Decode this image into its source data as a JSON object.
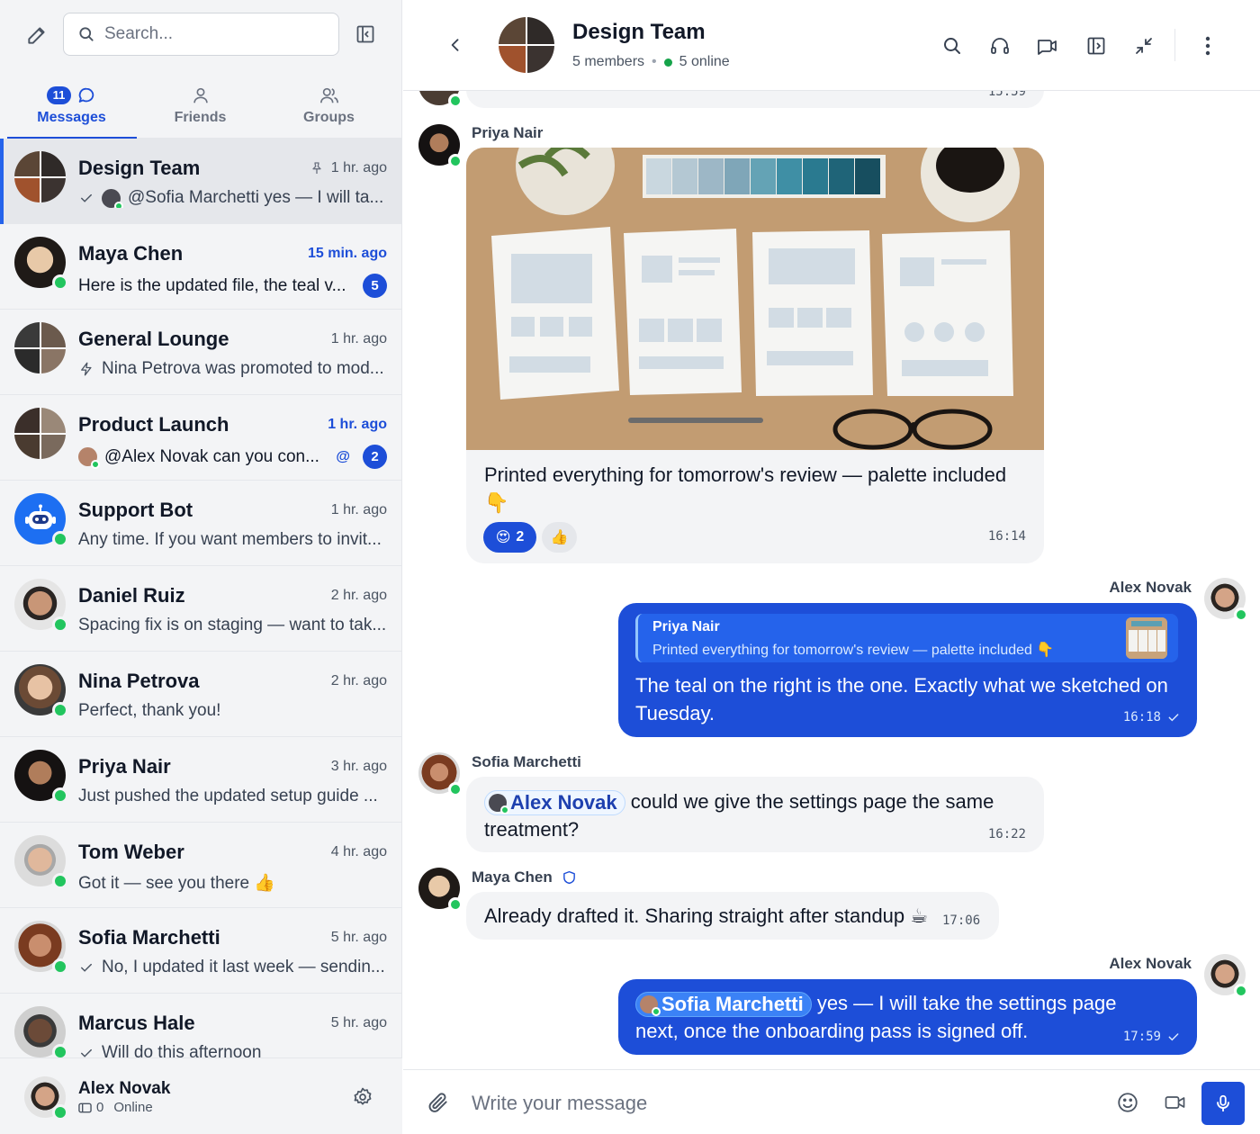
{
  "search": {
    "placeholder": "Search..."
  },
  "tabs": [
    {
      "label": "Messages",
      "badge": "11"
    },
    {
      "label": "Friends"
    },
    {
      "label": "Groups"
    }
  ],
  "conversations": [
    {
      "name": "Design Team",
      "time": "1 hr. ago",
      "preview": "@Sofia Marchetti yes — I will ta..."
    },
    {
      "name": "Maya Chen",
      "time": "15 min. ago",
      "preview": "Here is the updated file, the teal v...",
      "unread": "5"
    },
    {
      "name": "General Lounge",
      "time": "1 hr. ago",
      "preview": "Nina Petrova was promoted to mod..."
    },
    {
      "name": "Product Launch",
      "time": "1 hr. ago",
      "preview": "@Alex Novak can you con...",
      "mention": "@",
      "unread": "2"
    },
    {
      "name": "Support Bot",
      "time": "1 hr. ago",
      "preview": "Any time. If you want members to invit..."
    },
    {
      "name": "Daniel Ruiz",
      "time": "2 hr. ago",
      "preview": "Spacing fix is on staging — want to tak..."
    },
    {
      "name": "Nina Petrova",
      "time": "2 hr. ago",
      "preview": "Perfect, thank you!"
    },
    {
      "name": "Priya Nair",
      "time": "3 hr. ago",
      "preview": "Just pushed the updated setup guide ..."
    },
    {
      "name": "Tom Weber",
      "time": "4 hr. ago",
      "preview": "Got it — see you there 👍"
    },
    {
      "name": "Sofia Marchetti",
      "time": "5 hr. ago",
      "preview": "No, I updated it last week — sendin..."
    },
    {
      "name": "Marcus Hale",
      "time": "5 hr. ago",
      "preview": "Will do this afternoon"
    }
  ],
  "me": {
    "name": "Alex Novak",
    "count": "0",
    "status": "Online"
  },
  "header": {
    "title": "Design Team",
    "members": "5 members",
    "online": "5 online"
  },
  "messages": {
    "prev_time": "15:59",
    "m1": {
      "sender": "Priya Nair",
      "text": "Printed everything for tomorrow's review — palette included 👇",
      "time": "16:14",
      "reaction1_count": "2",
      "reaction1_emoji": "😍",
      "reaction2_emoji": "👍"
    },
    "m2": {
      "sender": "Alex Novak",
      "reply_name": "Priya Nair",
      "reply_text": "Printed everything for tomorrow's review — palette included 👇",
      "text": "The teal on the right is the one. Exactly what we sketched on Tuesday.",
      "time": "16:18"
    },
    "m3": {
      "sender": "Sofia Marchetti",
      "mention": "Alex Novak",
      "text": " could we give the settings page the same treatment?",
      "time": "16:22"
    },
    "m4": {
      "sender": "Maya Chen",
      "text": "Already drafted it. Sharing straight after standup ☕",
      "time": "17:06"
    },
    "m5": {
      "sender": "Alex Novak",
      "mention": "Sofia Marchetti",
      "text": " yes — I will take the settings page next, once the onboarding pass is signed off.",
      "time": "17:59"
    }
  },
  "composer": {
    "placeholder": "Write your message"
  },
  "colors": {
    "accent": "#1d4ed8",
    "online": "#22c55e",
    "sidebar_bg": "#f3f4f6",
    "incoming_bubble": "#f3f4f6"
  },
  "icons": [
    "compose-icon",
    "search-icon",
    "collapse-sidebar-icon",
    "chat-bubble-icon",
    "user-icon",
    "users-icon",
    "pin-icon",
    "check-icon",
    "bolt-icon",
    "settings-icon",
    "back-icon",
    "headphones-icon",
    "video-icon",
    "panel-icon",
    "minimize-icon",
    "more-vertical-icon",
    "shield-icon",
    "paperclip-icon",
    "emoji-icon",
    "camera-icon",
    "mic-icon"
  ]
}
